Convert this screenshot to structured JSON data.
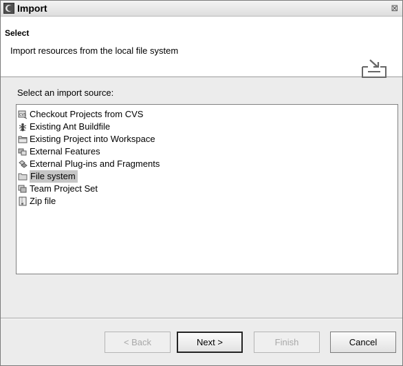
{
  "window": {
    "title": "Import",
    "close_symbol": "⊠"
  },
  "banner": {
    "title": "Select",
    "description": "Import resources from the local file system",
    "icon": "import-wizard-icon"
  },
  "source": {
    "label": "Select an import source:",
    "items": [
      {
        "label": "Checkout Projects from CVS",
        "icon": "cvs-checkout-icon",
        "selected": false
      },
      {
        "label": "Existing Ant Buildfile",
        "icon": "ant-icon",
        "selected": false
      },
      {
        "label": "Existing Project into Workspace",
        "icon": "project-folder-icon",
        "selected": false
      },
      {
        "label": "External Features",
        "icon": "features-icon",
        "selected": false
      },
      {
        "label": "External Plug-ins and Fragments",
        "icon": "plugins-icon",
        "selected": false
      },
      {
        "label": "File system",
        "icon": "folder-icon",
        "selected": true
      },
      {
        "label": "Team Project Set",
        "icon": "team-project-set-icon",
        "selected": false
      },
      {
        "label": "Zip file",
        "icon": "zip-file-icon",
        "selected": false
      }
    ]
  },
  "buttons": {
    "back": "< Back",
    "next": "Next >",
    "finish": "Finish",
    "cancel": "Cancel"
  }
}
